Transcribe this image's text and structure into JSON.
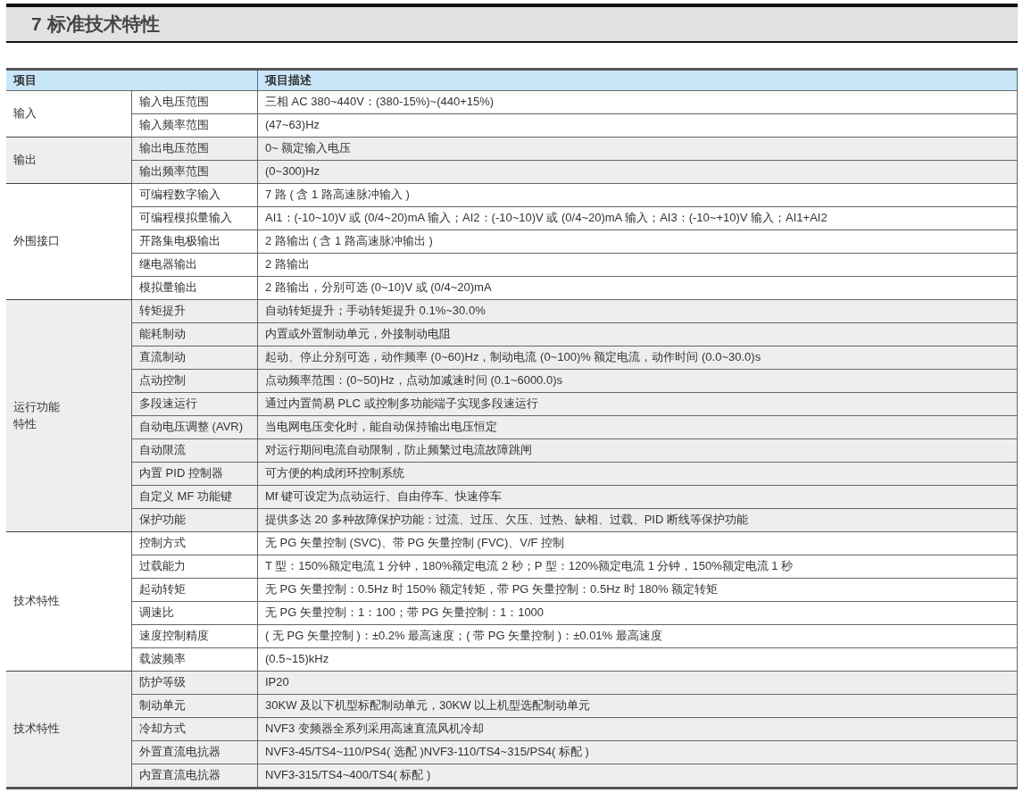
{
  "title": "7 标准技术特性",
  "table": {
    "columns": [
      "项目",
      "项目描述"
    ],
    "groups": [
      {
        "label": "输入",
        "rows": [
          {
            "item": "输入电压范围",
            "description": "三相 AC 380~440V：(380-15%)~(440+15%)"
          },
          {
            "item": "输入频率范围",
            "description": "(47~63)Hz"
          }
        ]
      },
      {
        "label": "输出",
        "rows": [
          {
            "item": "输出电压范围",
            "description": "0~ 额定输入电压"
          },
          {
            "item": "输出频率范围",
            "description": "(0~300)Hz"
          }
        ]
      },
      {
        "label": "外围接口",
        "rows": [
          {
            "item": "可编程数字输入",
            "description": "7 路 ( 含 1 路高速脉冲输入 )"
          },
          {
            "item": "可编程模拟量输入",
            "description": "AI1：(-10~10)V 或 (0/4~20)mA 输入；AI2：(-10~10)V 或 (0/4~20)mA 输入；AI3：(-10~+10)V 输入；AI1+AI2"
          },
          {
            "item": "开路集电极输出",
            "description": "2 路输出 ( 含 1 路高速脉冲输出 )"
          },
          {
            "item": "继电器输出",
            "description": "2 路输出"
          },
          {
            "item": "模拟量输出",
            "description": "2 路输出，分别可选 (0~10)V 或 (0/4~20)mA"
          }
        ]
      },
      {
        "label": "运行功能特性",
        "rows": [
          {
            "item": "转矩提升",
            "description": "自动转矩提升；手动转矩提升 0.1%~30.0%"
          },
          {
            "item": "能耗制动",
            "description": "内置或外置制动单元，外接制动电阻"
          },
          {
            "item": "直流制动",
            "description": "起动、停止分别可选，动作频率 (0~60)Hz，制动电流 (0~100)% 额定电流，动作时间 (0.0~30.0)s"
          },
          {
            "item": "点动控制",
            "description": "点动频率范围：(0~50)Hz，点动加减速时间 (0.1~6000.0)s"
          },
          {
            "item": "多段速运行",
            "description": "通过内置简易 PLC 或控制多功能端子实现多段速运行"
          },
          {
            "item": "自动电压调整 (AVR)",
            "description": "当电网电压变化时，能自动保持输出电压恒定"
          },
          {
            "item": "自动限流",
            "description": "对运行期间电流自动限制，防止频繁过电流故障跳闸"
          },
          {
            "item": "内置 PID 控制器",
            "description": "可方便的构成闭环控制系统"
          },
          {
            "item": "自定义 MF 功能键",
            "description": "Mf 键可设定为点动运行、自由停车、快速停车"
          },
          {
            "item": "保护功能",
            "description": "提供多达 20 多种故障保护功能：过流、过压、欠压、过热、缺相、过载、PID 断线等保护功能"
          }
        ]
      },
      {
        "label": "技术特性",
        "rows": [
          {
            "item": "控制方式",
            "description": "无 PG 矢量控制 (SVC)、带 PG 矢量控制 (FVC)、V/F 控制"
          },
          {
            "item": "过载能力",
            "description": "T 型：150%额定电流 1 分钟，180%额定电流 2 秒；P 型：120%额定电流 1 分钟，150%额定电流 1 秒"
          },
          {
            "item": "起动转矩",
            "description": "无 PG 矢量控制：0.5Hz 时 150% 额定转矩，带 PG 矢量控制：0.5Hz 时 180% 额定转矩"
          },
          {
            "item": "调速比",
            "description": "无 PG 矢量控制：1：100；带 PG 矢量控制：1：1000"
          },
          {
            "item": "速度控制精度",
            "description": "( 无 PG 矢量控制 )：±0.2% 最高速度；( 带 PG 矢量控制 )：±0.01% 最高速度"
          },
          {
            "item": "载波频率",
            "description": "(0.5~15)kHz"
          }
        ]
      },
      {
        "label": "技术特性",
        "rows": [
          {
            "item": "防护等级",
            "description": "IP20"
          },
          {
            "item": "制动单元",
            "description": "30KW 及以下机型标配制动单元，30KW 以上机型选配制动单元"
          },
          {
            "item": "冷却方式",
            "description": "NVF3 变频器全系列采用高速直流风机冷却"
          },
          {
            "item": "外置直流电抗器",
            "description": "NVF3-45/TS4~110/PS4( 选配 )NVF3-110/TS4~315/PS4( 标配 )"
          },
          {
            "item": "内置直流电抗器",
            "description": "NVF3-315/TS4~400/TS4( 标配 )"
          }
        ]
      }
    ]
  }
}
